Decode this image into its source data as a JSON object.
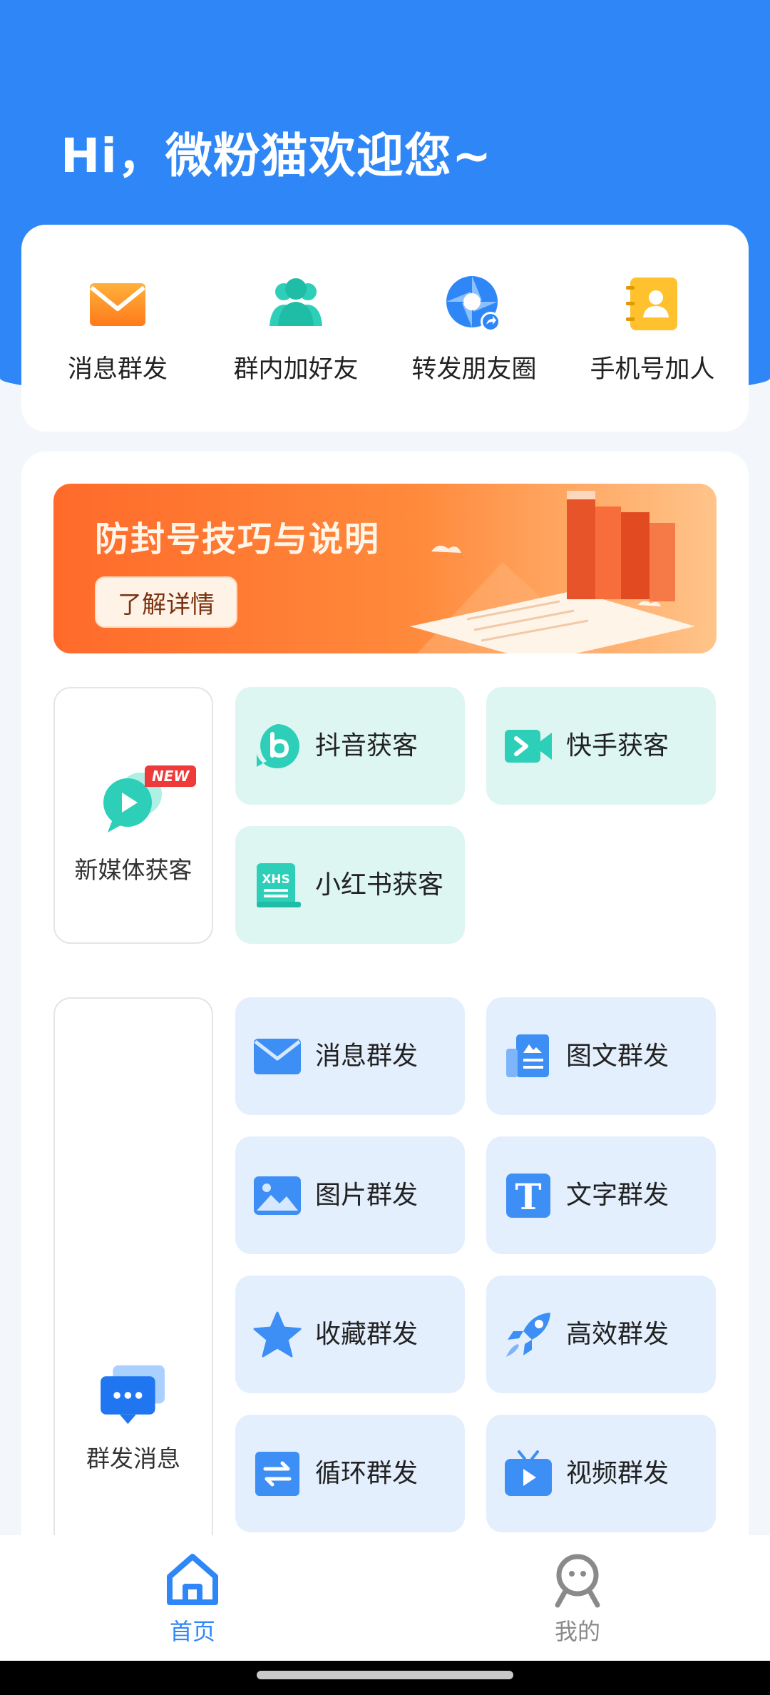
{
  "header": {
    "greeting": "Hi，微粉猫欢迎您~"
  },
  "quick_actions": [
    {
      "label": "消息群发",
      "icon": "envelope-icon"
    },
    {
      "label": "群内加好友",
      "icon": "people-icon"
    },
    {
      "label": "转发朋友圈",
      "icon": "shutter-share-icon"
    },
    {
      "label": "手机号加人",
      "icon": "contact-book-icon"
    }
  ],
  "banner": {
    "title": "防封号技巧与说明",
    "button": "了解详情"
  },
  "new_media": {
    "label": "新媒体获客",
    "badge": "NEW",
    "tiles": [
      {
        "label": "抖音获客",
        "icon": "douyin-icon"
      },
      {
        "label": "快手获客",
        "icon": "kuaishou-icon"
      },
      {
        "label": "小红书获客",
        "icon": "xiaohongshu-icon",
        "icon_text": "XHS"
      }
    ]
  },
  "group_send": {
    "label": "群发消息",
    "tiles": [
      {
        "label": "消息群发",
        "icon": "envelope-icon"
      },
      {
        "label": "图文群发",
        "icon": "newspaper-icon"
      },
      {
        "label": "图片群发",
        "icon": "image-icon"
      },
      {
        "label": "文字群发",
        "icon": "text-icon",
        "icon_text": "T"
      },
      {
        "label": "收藏群发",
        "icon": "star-icon"
      },
      {
        "label": "高效群发",
        "icon": "rocket-icon"
      },
      {
        "label": "循环群发",
        "icon": "loop-icon"
      },
      {
        "label": "视频群发",
        "icon": "tv-play-icon"
      }
    ]
  },
  "nav": {
    "items": [
      {
        "label": "首页",
        "icon": "home-icon",
        "active": true
      },
      {
        "label": "我的",
        "icon": "profile-icon",
        "active": false
      }
    ]
  },
  "colors": {
    "primary": "#2f87f7",
    "green_tile": "#ddf6f2",
    "blue_tile": "#e4effd",
    "teal": "#2dcfb8",
    "orange": "#ff7a2a"
  }
}
